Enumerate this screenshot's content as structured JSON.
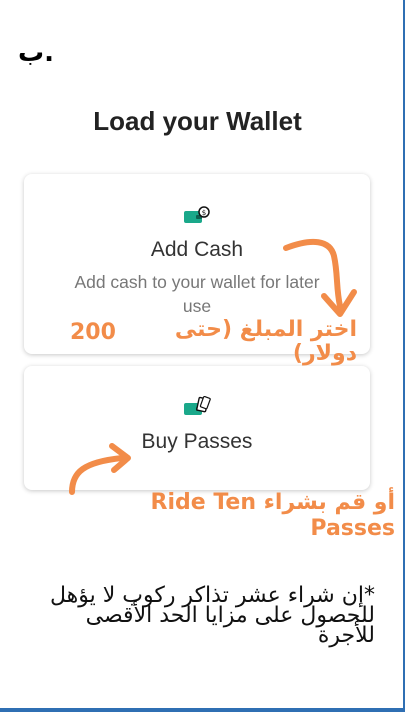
{
  "step_label": "ب.",
  "title": "Load your Wallet",
  "cards": [
    {
      "title": "Add Cash",
      "subtitle": "Add cash to your wallet for later use",
      "icon": "wallet-cash-icon"
    },
    {
      "title": "Buy Passes",
      "icon": "wallet-passes-icon"
    }
  ],
  "annotations": {
    "add_cash_note": "اختر المبلغ (حتى",
    "add_cash_note_line2": "دولار)",
    "add_cash_amount": "200",
    "buy_passes_note": "أو قم بشراء Ride Ten Passes"
  },
  "footer_note": "*إن شراء عشر تذاكر ركوب لا يؤهل للحصول على مزايا الحد الأقصى للأجرة",
  "colors": {
    "accent": "#f28c49",
    "icon_green": "#1aa88a",
    "frame": "#2f6fb3"
  }
}
